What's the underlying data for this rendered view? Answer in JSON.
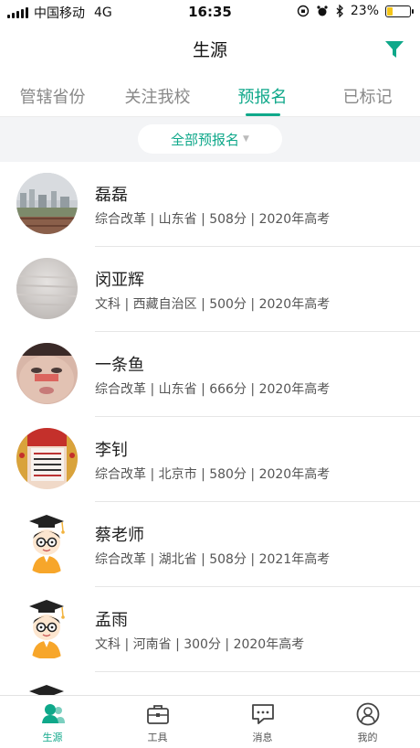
{
  "status_bar": {
    "carrier": "中国移动",
    "network": "4G",
    "time": "16:35",
    "battery": "23%",
    "battery_level": 0.23
  },
  "nav": {
    "title": "生源",
    "filter_icon": "filter-icon"
  },
  "tabs": [
    {
      "label": "管辖省份",
      "active": false
    },
    {
      "label": "关注我校",
      "active": false
    },
    {
      "label": "预报名",
      "active": true
    },
    {
      "label": "已标记",
      "active": false
    }
  ],
  "dropdown": {
    "label": "全部预报名"
  },
  "students": [
    {
      "name": "磊磊",
      "meta": "综合改革 | 山东省 | 508分 | 2020年高考",
      "avatar": "photo-cityscape"
    },
    {
      "name": "闵亚辉",
      "meta": "文科 | 西藏自治区 | 500分 | 2020年高考",
      "avatar": "photo-blurred"
    },
    {
      "name": "一条鱼",
      "meta": "综合改革 | 山东省 | 666分 | 2020年高考",
      "avatar": "photo-face"
    },
    {
      "name": "李钊",
      "meta": "综合改革 | 北京市 | 580分 | 2020年高考",
      "avatar": "photo-banner"
    },
    {
      "name": "蔡老师",
      "meta": "综合改革 | 湖北省 | 508分 | 2021年高考",
      "avatar": "cartoon-graduate"
    },
    {
      "name": "孟雨",
      "meta": "文科 | 河南省 | 300分 | 2020年高考",
      "avatar": "cartoon-graduate"
    }
  ],
  "tab_bar": [
    {
      "label": "生源",
      "icon": "people-icon",
      "active": true
    },
    {
      "label": "工具",
      "icon": "toolbox-icon",
      "active": false
    },
    {
      "label": "消息",
      "icon": "message-icon",
      "active": false
    },
    {
      "label": "我的",
      "icon": "profile-icon",
      "active": false
    }
  ],
  "colors": {
    "accent": "#0fa88a",
    "tab_inactive": "#888888",
    "strip_bg": "#f3f4f6"
  }
}
